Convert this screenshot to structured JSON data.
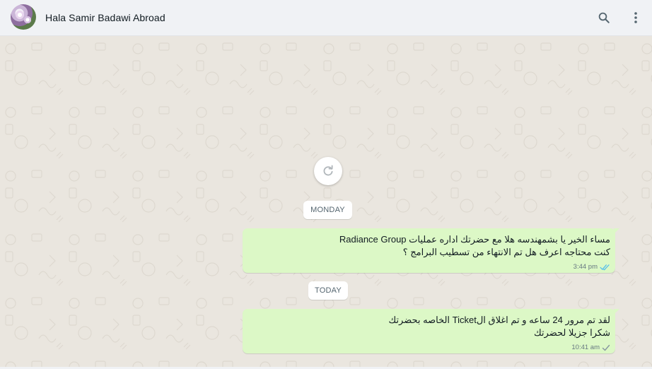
{
  "header": {
    "contact_name": "Hala Samir Badawi Abroad",
    "avatar_icon": "avatar-image",
    "search_icon": "search-icon",
    "menu_icon": "kebab-menu-icon"
  },
  "chat": {
    "reload_icon": "refresh-icon",
    "groups": [
      {
        "date_label": "MONDAY",
        "messages": [
          {
            "direction": "outgoing",
            "lines": [
              "مساء الخير يا بشمهندسه هلا مع حضرتك اداره عمليات Radiance Group",
              "كنت محتاجه اعرف هل تم الانتهاء من تسطيب البرامج ؟"
            ],
            "time": "3:44 pm",
            "status": "read",
            "status_icon": "double-check-icon",
            "status_color": "#53bdeb"
          }
        ]
      },
      {
        "date_label": "TODAY",
        "messages": [
          {
            "direction": "outgoing",
            "lines": [
              "لقد تم مرور 24 ساعه و تم اغلاق الTicket الخاصه بحضرتك",
              "شكرا جزيلا لحضرتك"
            ],
            "time": "10:41 am",
            "status": "sent",
            "status_icon": "single-check-icon",
            "status_color": "#8696a0"
          }
        ]
      }
    ]
  },
  "colors": {
    "header_bg": "#f0f2f5",
    "chat_bg": "#eae6df",
    "outgoing_bubble": "#dcf8c6",
    "date_chip_bg": "#ffffff"
  }
}
